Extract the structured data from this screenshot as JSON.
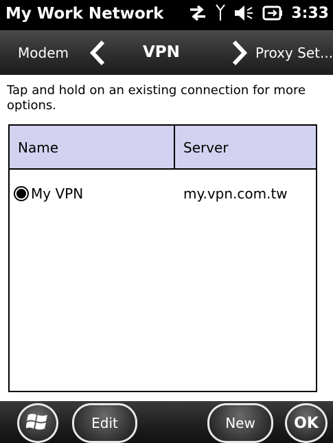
{
  "status_bar": {
    "title": "My Work Network",
    "time": "3:33",
    "icons": [
      "data-sync-icon",
      "signal-antenna-icon",
      "speaker-icon",
      "battery-charging-icon"
    ]
  },
  "tabs": {
    "previous": "Modem",
    "current": "VPN",
    "next": "Proxy Set..."
  },
  "content": {
    "hint": "Tap and hold on an existing connection for more options."
  },
  "list": {
    "columns": [
      "Name",
      "Server"
    ],
    "rows": [
      {
        "name": "My VPN",
        "server": "my.vpn.com.tw",
        "selected": true
      }
    ]
  },
  "bottom_bar": {
    "edit": "Edit",
    "new": "New",
    "ok": "OK"
  }
}
